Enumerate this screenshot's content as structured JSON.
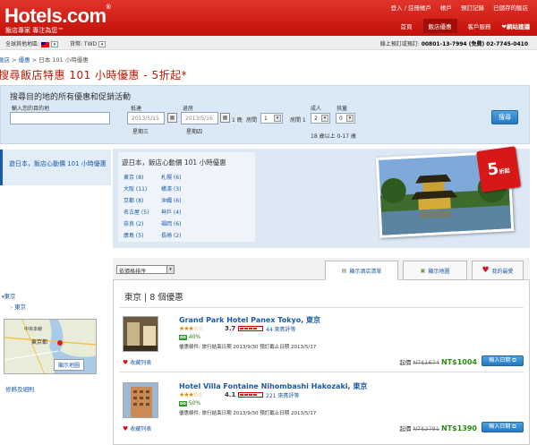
{
  "header": {
    "logo": "Hotels.com",
    "tagline": "飯店專家  專注為您™",
    "top_links": [
      "登入 / 註冊帳戶",
      "帳戶",
      "預訂記錄",
      "已儲存的飯店"
    ],
    "nav_tabs": [
      "首頁",
      "飯店優惠",
      "客戶服務"
    ],
    "deals_link": "❤網站建議"
  },
  "subbar": {
    "location_label": "全球其他地區:",
    "currency_label": "貨幣: TWD",
    "phone_label": "線上預訂或預訂:",
    "phone_number": "00801-13-7994 (免費) 02-7745-0410"
  },
  "breadcrumb": [
    "飯店",
    "優惠",
    "日本 101 小時優惠"
  ],
  "page_title": "搜尋飯店特惠 101 小時優惠 - 5折起*",
  "search": {
    "title": "搜尋目的地的所有優惠和促銷活動",
    "dest_label": "輸入您的目的地",
    "dest_placeholder": "",
    "checkin_label": "抵達",
    "checkin_value": "2013/5/15",
    "checkin_day": "星期三",
    "checkout_label": "退房",
    "checkout_value": "2013/5/16",
    "checkout_day": "星期四",
    "nights": "1 晚",
    "rooms_label": "房間",
    "rooms_value": "1",
    "room1_label": "房間 1",
    "adults_label": "成人",
    "adults_value": "2",
    "children_label": "孩童",
    "children_value": "0",
    "age_note": "18 歲以上  0-17 歲",
    "search_button": "搜尋"
  },
  "sidebar": {
    "promo_link": "遊日本，飯店心動價 101 小時優惠",
    "tree": [
      "東京",
      "東京"
    ],
    "map_link": "顯示地圖",
    "filter_link": "修飾及細則",
    "map_labels": [
      "中央本線",
      "東京都"
    ]
  },
  "promo": {
    "title": "遊日本，飯店心動價 101 小時優惠",
    "cities_left": [
      "東京 (8)",
      "大阪 (11)",
      "京都 (8)",
      "名古屋 (5)",
      "奈良 (2)",
      "廣島 (5)"
    ],
    "cities_right": [
      "札幌 (6)",
      "橫濱 (3)",
      "沖繩 (6)",
      "神戶 (4)",
      "福岡 (6)",
      "長崎 (2)"
    ],
    "badge": "5",
    "badge_suffix": "折起"
  },
  "toolbar": {
    "sort_label": "依價格排序",
    "tab_list": "顯示酒店清單",
    "tab_map": "顯示地圖",
    "tab_fav": "我的最愛"
  },
  "results": {
    "heading": "東京 | 8 個優惠",
    "hotels": [
      {
        "name": "Grand Park Hotel Panex Tokyo, 東京",
        "stars": "★★★☆☆",
        "score": "3.7",
        "reviews": "44 來賓評等",
        "tripadvisor": "40%",
        "conditions": "優惠條件: 旅行結束日期 2013/9/30    預訂截止日期 2013/5/17",
        "wishlist": "收藏列表",
        "price_label": "起價",
        "old_price": "NT$1674",
        "new_price": "NT$1004",
        "book_button": "輸入日期"
      },
      {
        "name": "Hotel Villa Fontaine Nihombashi Hakozaki, 東京",
        "stars": "★★★☆☆",
        "score": "4.1",
        "reviews": "221 來賓評等",
        "tripadvisor": "50%",
        "conditions": "優惠條件: 旅行結束日期 2013/9/30    預訂截止日期 2013/5/17",
        "wishlist": "收藏列表",
        "price_label": "起價",
        "old_price": "NT$2781",
        "new_price": "NT$1390",
        "book_button": "輸入日期"
      }
    ]
  }
}
